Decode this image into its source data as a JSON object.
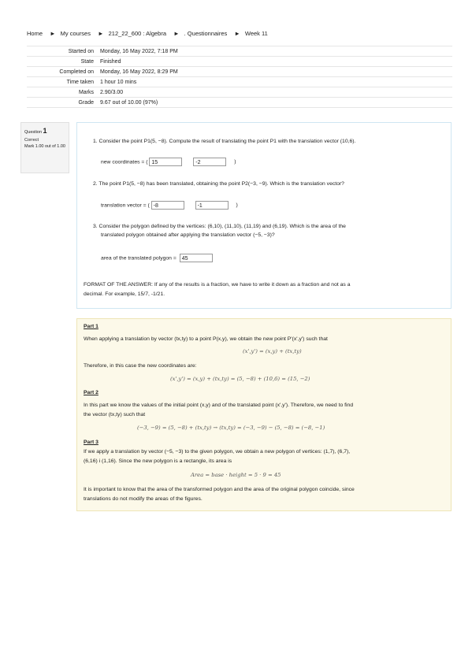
{
  "breadcrumb": [
    "Home",
    "My courses",
    "212_22_600 : Algebra",
    ". Questionnaires",
    "Week 11"
  ],
  "breadcrumb_sep": "►",
  "summary": [
    {
      "label": "Started on",
      "value": "Monday, 16 May 2022, 7:18 PM"
    },
    {
      "label": "State",
      "value": "Finished"
    },
    {
      "label": "Completed on",
      "value": "Monday, 16 May 2022, 8:29 PM"
    },
    {
      "label": "Time taken",
      "value": "1 hour 10 mins"
    },
    {
      "label": "Marks",
      "value": "2.90/3.00"
    },
    {
      "label": "Grade",
      "value": "9.67 out of 10.00 (97%)"
    }
  ],
  "question_info": {
    "label": "Question",
    "number": "1",
    "status": "Correct",
    "mark": "Mark 1.00 out of 1.00"
  },
  "question": {
    "q1": "1. Consider the point P1(5, −8). Compute the result of translating the point P1 with the translation vector (10,6).",
    "q1_label": "new coordinates = (",
    "q1_val1": "15",
    "q1_val2": "-2",
    "close_paren": ")",
    "q2": "2. The point P1(5, −8) has been translated, obtaining the point P2(−3, −9). Which is the translation vector?",
    "q2_label": "translation vector = (",
    "q2_val1": "-8",
    "q2_val2": "-1",
    "q3a": "3. Consider the polygon defined by the vertices: (6,10), (11,10), (11,19) and (6,19). Which is the area of the",
    "q3b": "translated polygon obtained after applying the translation vector (−5, −3)?",
    "q3_label": "area of the translated polygon =",
    "q3_val": "45",
    "format_a": "FORMAT OF THE ANSWER: If any of the results is a fraction, we have to write it down as a fraction and not as a",
    "format_b": "decimal. For example, 15/7, -1/21."
  },
  "feedback": {
    "part1": "Part 1",
    "p1_text": "When applying a translation by vector (tx,ty) to a point P(x,y), we obtain the new point P'(x',y') such that",
    "p1_eq": "(x',y') = (x,y) + (tx,ty)",
    "p1_therefore": "Therefore, in this case the new coordinates are:",
    "p1_eq2": "(x',y') = (x,y) + (tx,ty) = (5, −8) + (10,6) = (15, −2)",
    "part2": "Part 2",
    "p2_text_a": "In this part we know the values of the initial point (x,y) and of the translated point (x',y'). Therefore, we need to find",
    "p2_text_b": "the vector (tx,ty) such that",
    "p2_eq": "(−3, −9) = (5, −8) + (tx,ty) → (tx,ty) = (−3, −9) − (5, −8) = (−8, −1)",
    "part3": "Part 3",
    "p3_text_a": "If we apply a translation by vector (−5, −3) to the given polygon, we obtain a new polygon of vertices: (1,7), (6,7),",
    "p3_text_b": "(6,16) i (1,16). Since the new polygon is a rectangle, its area is",
    "p3_eq": "Area = base · height = 5 · 9 = 45",
    "conclusion_a": "It is important to know that the area of the transformed polygon and the area of the original polygon coincide, since",
    "conclusion_b": "translations do not modify the areas of the figures."
  }
}
